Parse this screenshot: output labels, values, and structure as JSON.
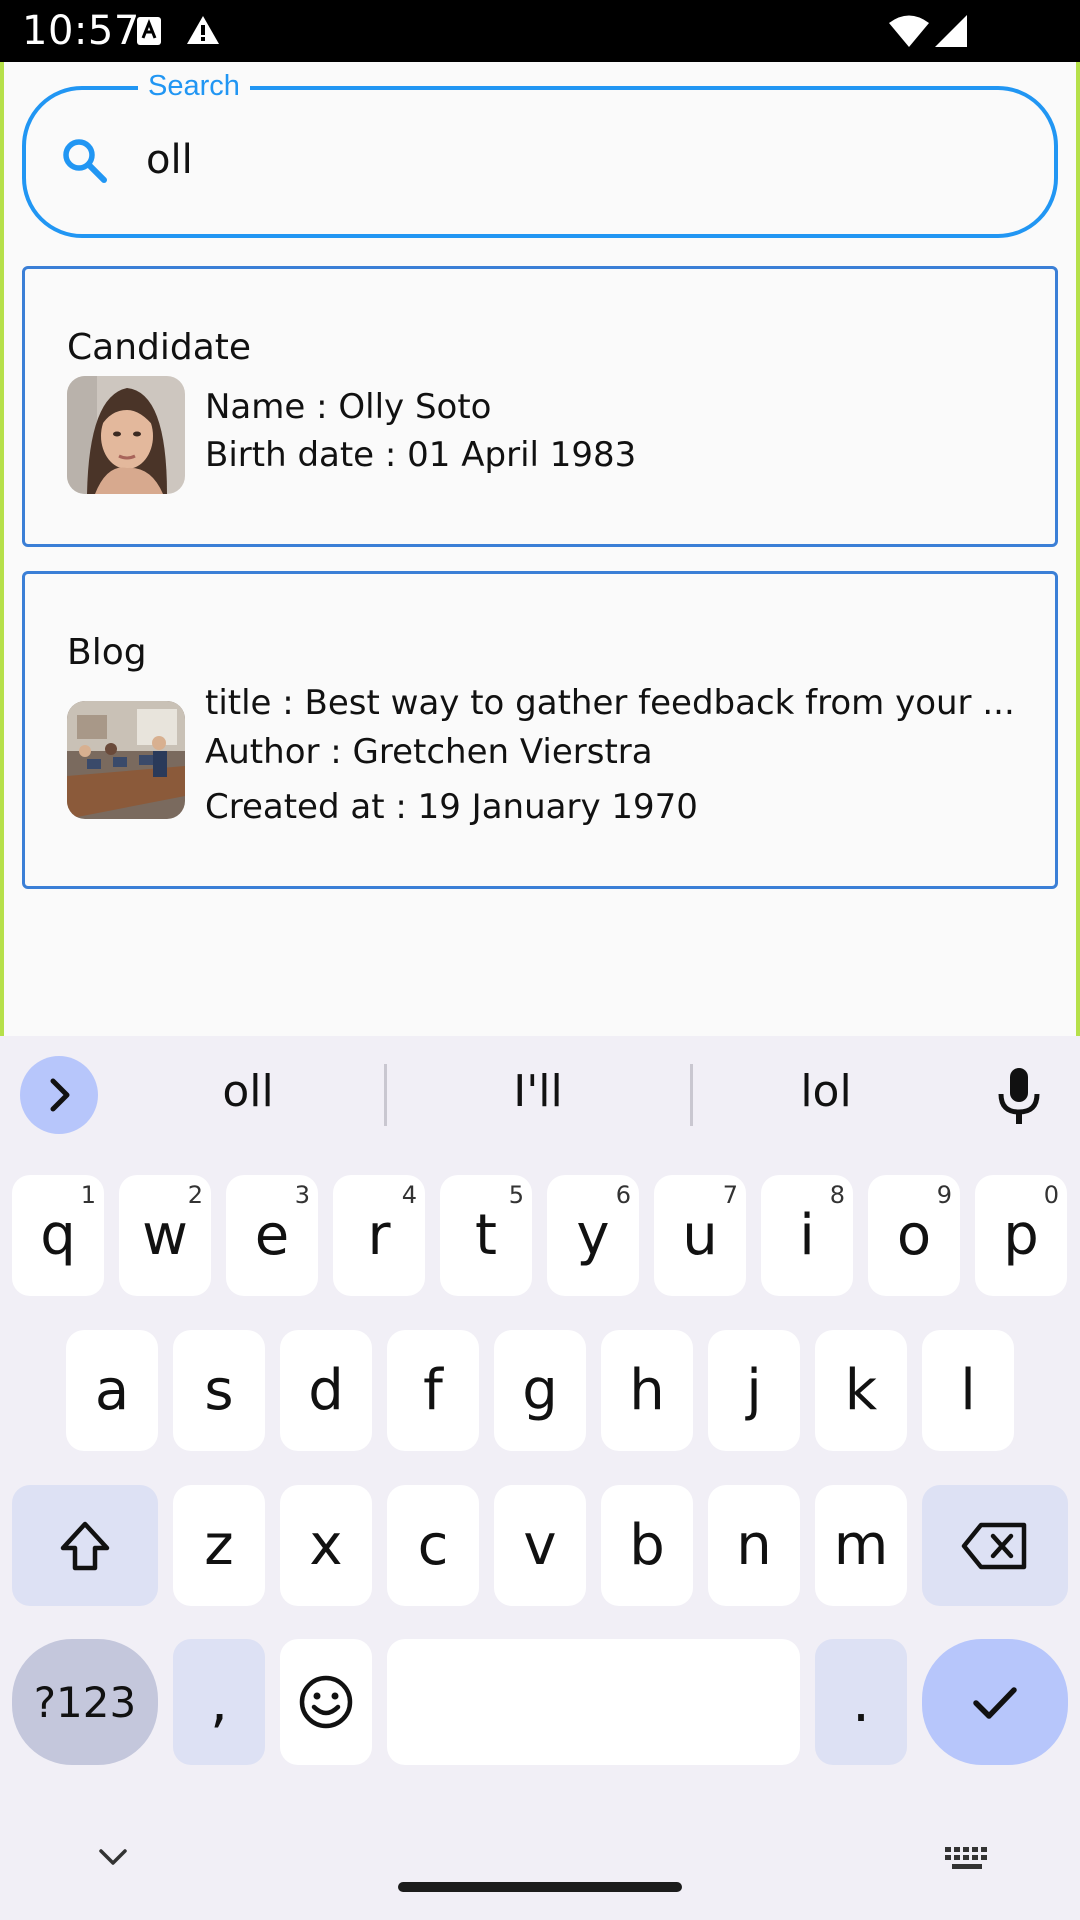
{
  "status_bar": {
    "time": "10:57",
    "icons": [
      "text-notification-icon",
      "warning-icon",
      "wifi-icon",
      "cellular-icon"
    ]
  },
  "search": {
    "label": "Search",
    "value": "oll",
    "icon": "search-icon",
    "accent": "#2196f3"
  },
  "results": {
    "candidate": {
      "title": "Candidate",
      "name": "Name : Olly Soto",
      "birth_date": "Birth date : 01 April 1983"
    },
    "blog": {
      "title": "Blog",
      "post_title": "title : Best way to gather feedback from your ...",
      "author": "Author : Gretchen Vierstra",
      "created_at": "Created at : 19 January 1970"
    }
  },
  "keyboard": {
    "suggestions": [
      "oll",
      "I'll",
      "lol"
    ],
    "row1": [
      {
        "k": "q",
        "s": "1"
      },
      {
        "k": "w",
        "s": "2"
      },
      {
        "k": "e",
        "s": "3"
      },
      {
        "k": "r",
        "s": "4"
      },
      {
        "k": "t",
        "s": "5"
      },
      {
        "k": "y",
        "s": "6"
      },
      {
        "k": "u",
        "s": "7"
      },
      {
        "k": "i",
        "s": "8"
      },
      {
        "k": "o",
        "s": "9"
      },
      {
        "k": "p",
        "s": "0"
      }
    ],
    "row2": [
      "a",
      "s",
      "d",
      "f",
      "g",
      "h",
      "j",
      "k",
      "l"
    ],
    "row3": [
      "z",
      "x",
      "c",
      "v",
      "b",
      "n",
      "m"
    ],
    "symbols_label": "?123",
    "comma": ",",
    "period": "."
  },
  "colors": {
    "card_border": "#3b7fd6",
    "keyboard_bg": "#f1eff6",
    "enter_key": "#b7c6fb",
    "edge_accent": "#b6e04a"
  }
}
